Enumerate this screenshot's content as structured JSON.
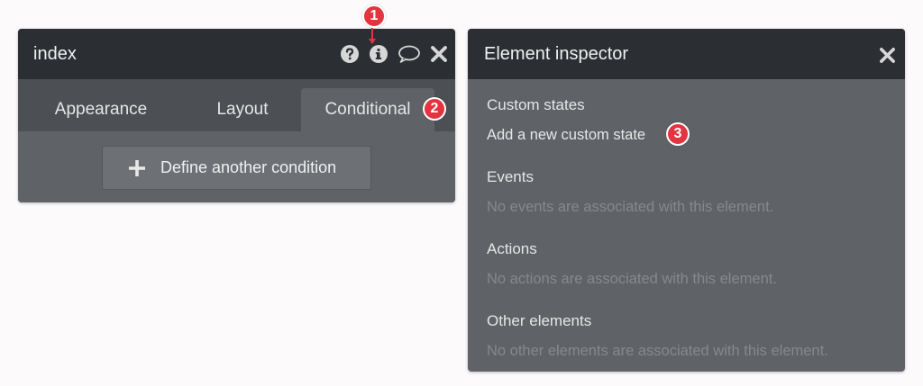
{
  "left_panel": {
    "title": "index",
    "icons": [
      "question-icon",
      "info-icon",
      "comment-icon",
      "close-icon"
    ],
    "tabs": [
      {
        "label": "Appearance"
      },
      {
        "label": "Layout"
      },
      {
        "label": "Conditional"
      }
    ],
    "define_button_label": "Define another condition"
  },
  "right_panel": {
    "title": "Element inspector",
    "sections": [
      {
        "title": "Custom states",
        "text": "Add a new custom state"
      },
      {
        "title": "Events",
        "text": "No events are associated with this element."
      },
      {
        "title": "Actions",
        "text": "No actions are associated with this element."
      },
      {
        "title": "Other elements",
        "text": "No other elements are associated with this element."
      }
    ]
  },
  "badges": [
    "1",
    "2",
    "3"
  ],
  "colors": {
    "header_bg": "#2b2f33",
    "panel_bg": "#5f6367",
    "tab_bar_bg": "#4c5054",
    "badge_red": "#e2353f"
  }
}
